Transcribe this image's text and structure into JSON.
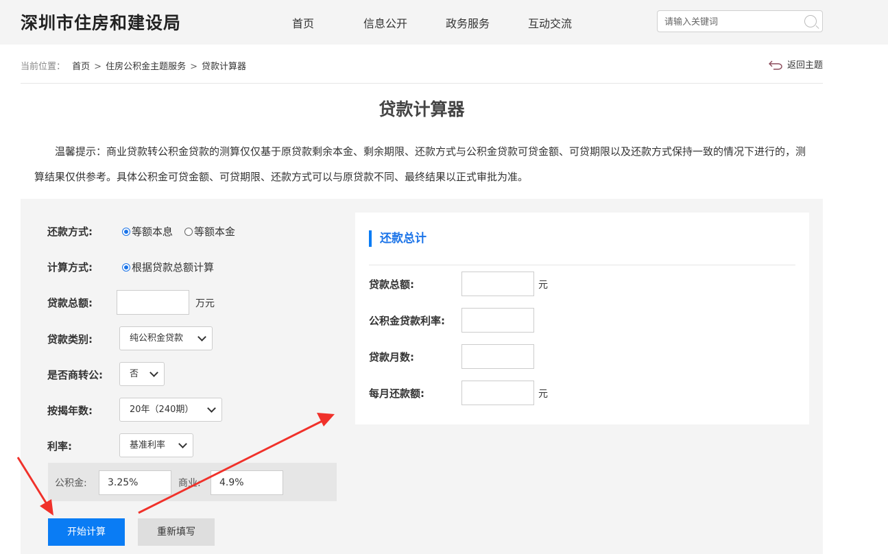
{
  "header": {
    "site_title": "深圳市住房和建设局",
    "nav": [
      "首页",
      "信息公开",
      "政务服务",
      "互动交流"
    ],
    "search_placeholder": "请输入关键词"
  },
  "breadcrumb": {
    "prefix": "当前位置：",
    "items": [
      "首页",
      "住房公积金主题服务",
      "贷款计算器"
    ],
    "back_label": "返回主题"
  },
  "page": {
    "title": "贷款计算器",
    "notice": "温馨提示：商业贷款转公积金贷款的测算仅仅基于原贷款剩余本金、剩余期限、还款方式与公积金贷款可贷金额、可贷期限以及还款方式保持一致的情况下进行的，测算结果仅供参考。具体公积金可贷金额、可贷期限、还款方式可以与原贷款不同、最终结果以正式审批为准。"
  },
  "form": {
    "repay_method_label": "还款方式:",
    "repay_options": [
      "等额本息",
      "等额本金"
    ],
    "calc_method_label": "计算方式:",
    "calc_option": "根据贷款总额计算",
    "loan_amount_label": "贷款总额:",
    "loan_amount_unit": "万元",
    "loan_type_label": "贷款类别:",
    "loan_type_value": "纯公积金贷款",
    "commercial_transfer_label": "是否商转公:",
    "commercial_transfer_value": "否",
    "years_label": "按揭年数:",
    "years_value": "20年（240期）",
    "rate_label": "利率:",
    "rate_value": "基准利率",
    "fund_rate_label": "公积金:",
    "fund_rate_value": "3.25%",
    "commercial_rate_label": "商业:",
    "commercial_rate_value": "4.9%",
    "calculate_button": "开始计算",
    "reset_button": "重新填写"
  },
  "result": {
    "title": "还款总计",
    "total_label": "贷款总额:",
    "total_unit": "元",
    "rate_label": "公积金贷款利率:",
    "months_label": "贷款月数:",
    "monthly_label": "每月还款额:",
    "monthly_unit": "元"
  },
  "colors": {
    "accent": "#0a7cf4",
    "annotation_arrow": "#f0312a",
    "panel_bg": "#f4f4f4"
  }
}
